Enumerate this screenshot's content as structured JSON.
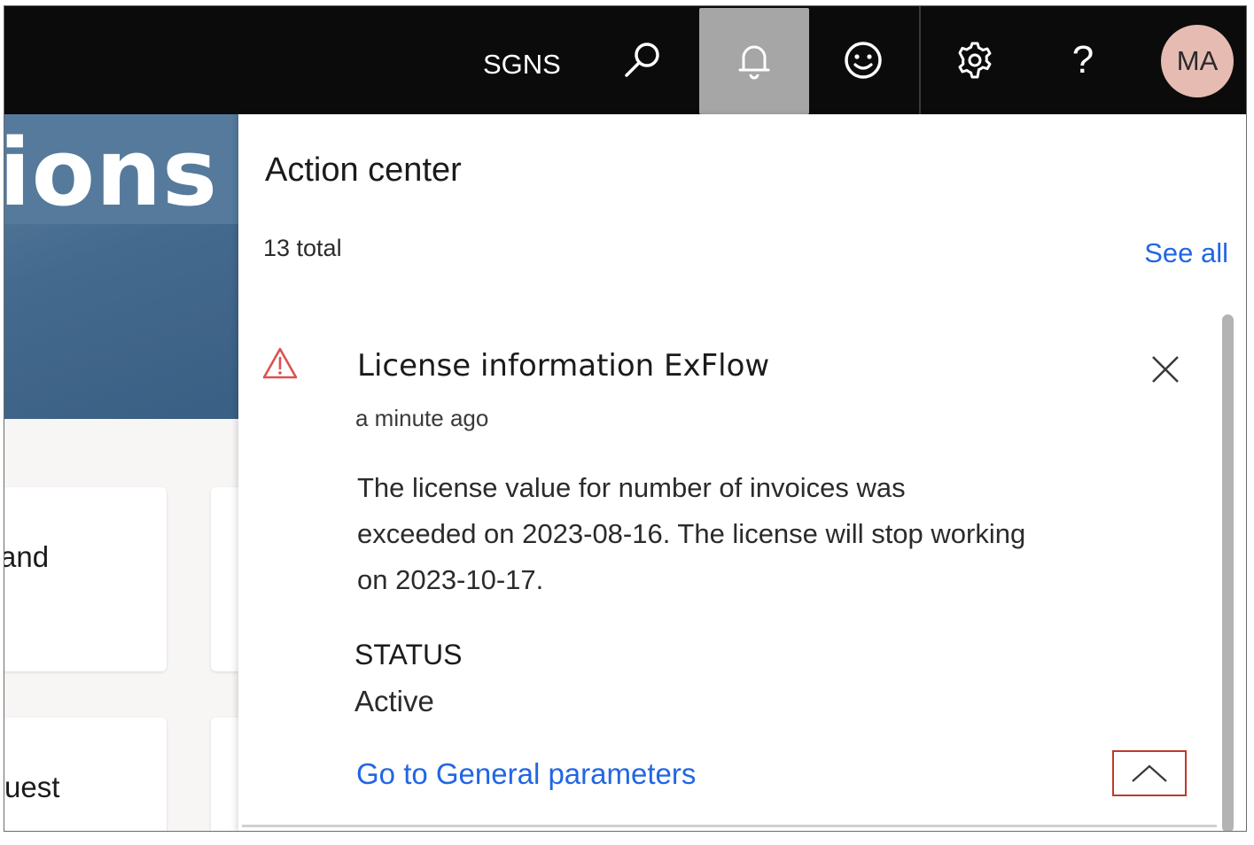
{
  "topbar": {
    "company": "SGNS",
    "avatar_initials": "MA",
    "help_glyph": "?",
    "icons": [
      "search-icon",
      "bell-icon",
      "smile-icon",
      "gear-icon",
      "help-icon"
    ]
  },
  "workspace": {
    "hero_title": "ions",
    "tiles": [
      "and",
      "uest"
    ]
  },
  "action_center": {
    "title": "Action center",
    "total": "13 total",
    "see_all": "See all",
    "notification": {
      "title": "License information ExFlow",
      "time": "a minute ago",
      "body": "The license value for number of invoices was exceeded on 2023-08-16. The license will stop working on 2023-10-17.",
      "status_label": "STATUS",
      "status_value": "Active",
      "link": "Go to General parameters",
      "icon": "warning-icon"
    }
  },
  "colors": {
    "topbar_bg": "#0b0b0b",
    "bell_active_bg": "#a6a6a6",
    "avatar_bg": "#e6bcb2",
    "link": "#2266e3",
    "warning": "#d9534f",
    "highlight_border": "#c0392b"
  }
}
